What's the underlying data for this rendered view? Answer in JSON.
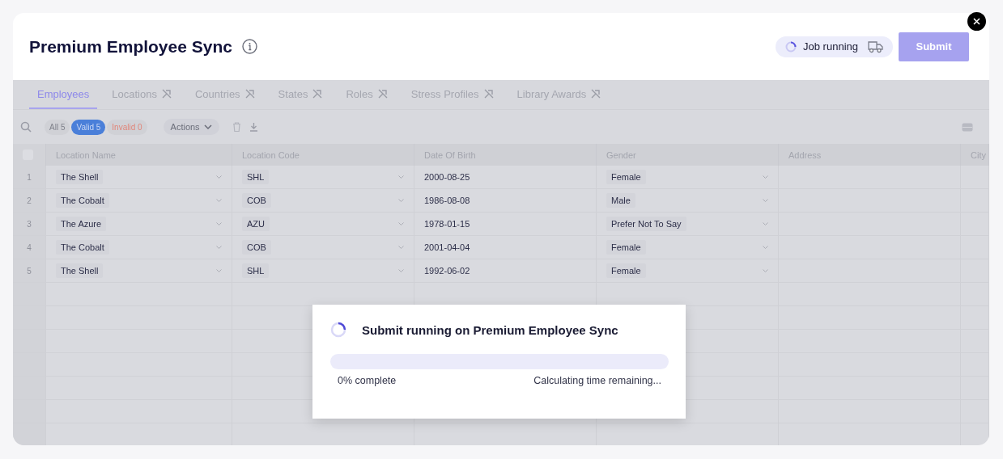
{
  "window": {
    "title": "Premium Employee Sync"
  },
  "job_status": {
    "label": "Job running"
  },
  "submit_button": {
    "label": "Submit",
    "disabled": true
  },
  "tabs": [
    {
      "label": "Employees",
      "selected": true,
      "kind": "plain"
    },
    {
      "label": "Locations",
      "selected": false,
      "kind": "linked"
    },
    {
      "label": "Countries",
      "selected": false,
      "kind": "linked"
    },
    {
      "label": "States",
      "selected": false,
      "kind": "linked"
    },
    {
      "label": "Roles",
      "selected": false,
      "kind": "linked"
    },
    {
      "label": "Stress Profiles",
      "selected": false,
      "kind": "linked"
    },
    {
      "label": "Library Awards",
      "selected": false,
      "kind": "linked"
    }
  ],
  "filters": [
    {
      "label": "All 5",
      "selected": false,
      "kind": "neutral"
    },
    {
      "label": "Valid 5",
      "selected": true,
      "kind": "neutral"
    },
    {
      "label": "Invalid 0",
      "selected": false,
      "kind": "error"
    }
  ],
  "actions_menu": {
    "label": "Actions"
  },
  "table": {
    "select_all": {
      "checked": false
    },
    "columns": [
      {
        "label": "Location Name",
        "kind": "select"
      },
      {
        "label": "Location Code",
        "kind": "select"
      },
      {
        "label": "Date Of Birth",
        "kind": "text"
      },
      {
        "label": "Gender",
        "kind": "select"
      },
      {
        "label": "Address",
        "kind": "text"
      },
      {
        "label": "City",
        "kind": "text"
      }
    ],
    "rows": [
      {
        "number": "1",
        "cells": [
          "The Shell",
          "SHL",
          "2000-08-25",
          "Female",
          "",
          ""
        ]
      },
      {
        "number": "2",
        "cells": [
          "The Cobalt",
          "COB",
          "1986-08-08",
          "Male",
          "",
          ""
        ]
      },
      {
        "number": "3",
        "cells": [
          "The Azure",
          "AZU",
          "1978-01-15",
          "Prefer Not To Say",
          "",
          ""
        ]
      },
      {
        "number": "4",
        "cells": [
          "The Cobalt",
          "COB",
          "2001-04-04",
          "Female",
          "",
          ""
        ]
      },
      {
        "number": "5",
        "cells": [
          "The Shell",
          "SHL",
          "1992-06-02",
          "Female",
          "",
          ""
        ]
      }
    ]
  },
  "progress_dialog": {
    "title": "Submit running on Premium Employee Sync",
    "level": 0,
    "percent_label": "0% complete",
    "time_label": "Calculating time remaining..."
  }
}
